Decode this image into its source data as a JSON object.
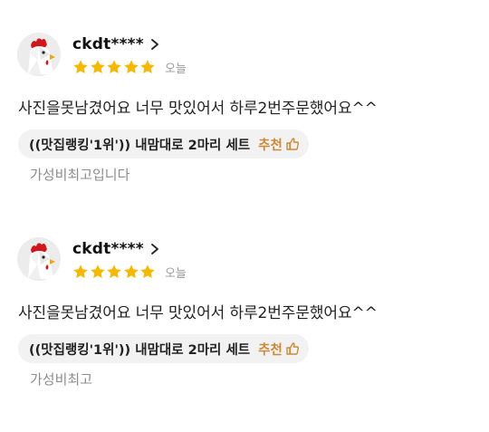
{
  "colors": {
    "star": "#f5b800",
    "recommend": "#c98a3a",
    "chip_bg": "#f2f2f2"
  },
  "reviews": [
    {
      "nickname": "ckdt****",
      "rating": 5,
      "date": "오늘",
      "text": "사진을못남겼어요 너무 맛있어서 하루2번주문했어요^^",
      "menu": "((맛집랭킹'1위')) 내맘대로 2마리 세트",
      "recommend_label": "추천",
      "option": "가성비최고입니다"
    },
    {
      "nickname": "ckdt****",
      "rating": 5,
      "date": "오늘",
      "text": "사진을못남겼어요 너무 맛있어서 하루2번주문했어요^^",
      "menu": "((맛집랭킹'1위')) 내맘대로 2마리 세트",
      "recommend_label": "추천",
      "option": "가성비최고"
    }
  ]
}
